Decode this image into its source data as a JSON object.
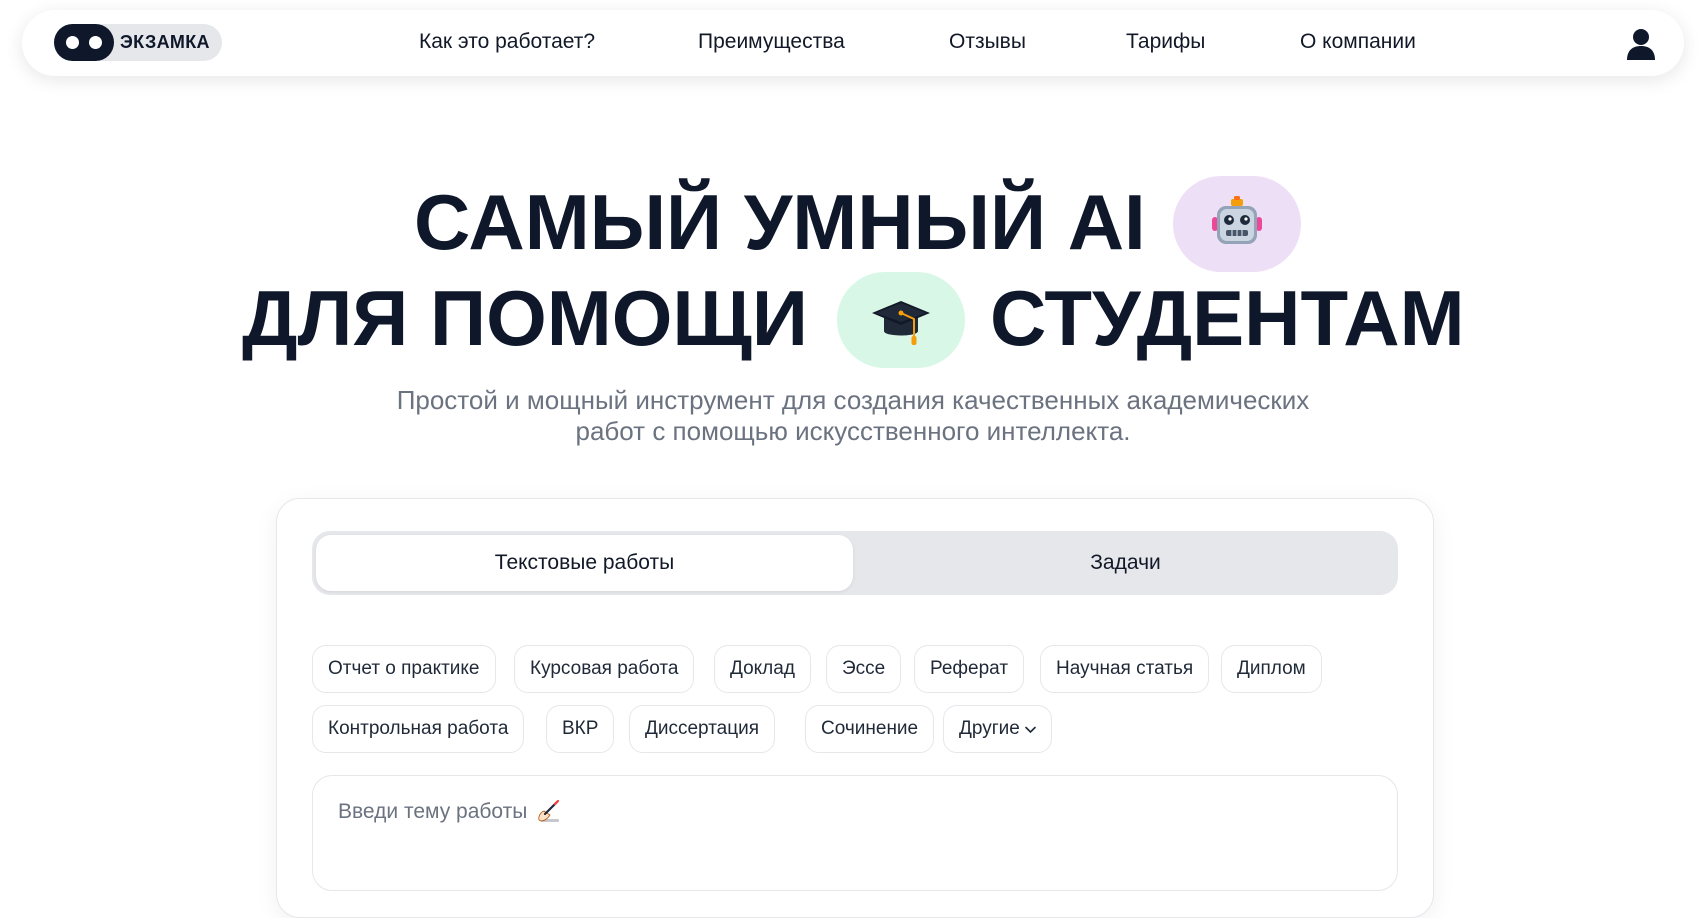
{
  "header": {
    "logo_text": "ЭКЗАМКА",
    "nav": [
      {
        "label": "Как это работает?"
      },
      {
        "label": "Преимущества"
      },
      {
        "label": "Отзывы"
      },
      {
        "label": "Тарифы"
      },
      {
        "label": "О компании"
      }
    ],
    "user_icon": "user-icon"
  },
  "hero": {
    "line1_part1": "САМЫЙ УМНЫЙ AI",
    "line1_emoji": "🤖",
    "line2_part1": "ДЛЯ ПОМОЩИ",
    "line2_emoji": "🎓",
    "line2_part2": "СТУДЕНТАМ",
    "subtitle_line1": "Простой и мощный инструмент для создания качественных академических",
    "subtitle_line2": "работ с помощью искусственного интеллекта."
  },
  "card": {
    "tabs": [
      {
        "label": "Текстовые работы",
        "active": true
      },
      {
        "label": "Задачи",
        "active": false
      }
    ],
    "chips_row1": [
      {
        "label": "Отчет о практике"
      },
      {
        "label": "Курсовая работа"
      },
      {
        "label": "Доклад"
      },
      {
        "label": "Эссе"
      },
      {
        "label": "Реферат"
      },
      {
        "label": "Научная статья"
      },
      {
        "label": "Диплом"
      }
    ],
    "chips_row2": [
      {
        "label": "Контрольная работа"
      },
      {
        "label": "ВКР"
      },
      {
        "label": "Диссертация"
      },
      {
        "label": "Сочинение"
      },
      {
        "label": "Другие"
      }
    ],
    "topic_placeholder": "Введи тему работы",
    "topic_emoji": "✍️"
  },
  "colors": {
    "text_primary": "#0f172a",
    "text_muted": "#6b7280",
    "robot_pill": "#ede0f6",
    "cap_pill": "#d9f7e6",
    "tab_track": "#e5e7eb",
    "border": "#e5e7eb"
  }
}
